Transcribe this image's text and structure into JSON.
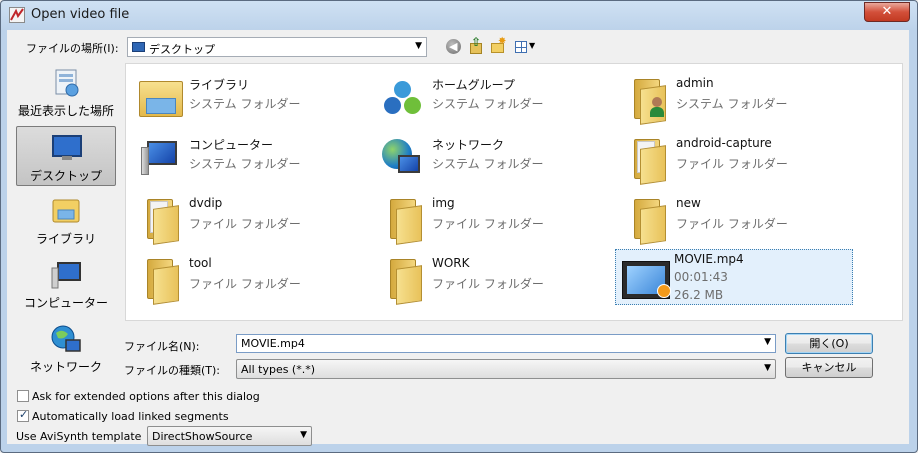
{
  "window": {
    "title": "Open video file",
    "close_glyph": "✕"
  },
  "lookin": {
    "label": "ファイルの場所(I):",
    "value": "デスクトップ",
    "arrow": "▼"
  },
  "toolbar": {
    "back_glyph": "◀",
    "up_glyph": "⇧",
    "new_folder_glyph": "✸",
    "view_arrow": "▼"
  },
  "places": [
    {
      "label": "最近表示した場所",
      "icon": "recent-places-icon"
    },
    {
      "label": "デスクトップ",
      "icon": "desktop-icon",
      "selected": true
    },
    {
      "label": "ライブラリ",
      "icon": "libraries-icon"
    },
    {
      "label": "コンピューター",
      "icon": "computer-icon"
    },
    {
      "label": "ネットワーク",
      "icon": "network-icon"
    }
  ],
  "files": [
    {
      "name": "ライブラリ",
      "type": "システム フォルダー",
      "icon": "library-icon"
    },
    {
      "name": "ホームグループ",
      "type": "システム フォルダー",
      "icon": "homegroup-icon"
    },
    {
      "name": "admin",
      "type": "システム フォルダー",
      "icon": "user-folder-icon"
    },
    {
      "name": "コンピューター",
      "type": "システム フォルダー",
      "icon": "computer-icon"
    },
    {
      "name": "ネットワーク",
      "type": "システム フォルダー",
      "icon": "network-icon"
    },
    {
      "name": "android-capture",
      "type": "ファイル フォルダー",
      "icon": "folder-icon"
    },
    {
      "name": "dvdip",
      "type": "ファイル フォルダー",
      "icon": "folder-icon"
    },
    {
      "name": "img",
      "type": "ファイル フォルダー",
      "icon": "folder-icon"
    },
    {
      "name": "new",
      "type": "ファイル フォルダー",
      "icon": "folder-icon"
    },
    {
      "name": "tool",
      "type": "ファイル フォルダー",
      "icon": "folder-icon"
    },
    {
      "name": "WORK",
      "type": "ファイル フォルダー",
      "icon": "folder-icon"
    },
    {
      "name": "MOVIE.mp4",
      "type": "00:01:43",
      "size": "26.2 MB",
      "icon": "video-file-icon",
      "selected": true
    }
  ],
  "filename": {
    "label": "ファイル名(N):",
    "value": "MOVIE.mp4",
    "arrow": "▼"
  },
  "filetype": {
    "label": "ファイルの種類(T):",
    "value": "All types (*.*)",
    "arrow": "▼"
  },
  "buttons": {
    "open": "開く(O)",
    "cancel": "キャンセル"
  },
  "options": {
    "extended": {
      "label": "Ask for extended options after this dialog",
      "checked": false
    },
    "linked": {
      "label": "Automatically load linked segments",
      "checked": true,
      "mark": "✓"
    },
    "avisynth_label": "Use AviSynth template",
    "avisynth_value": "DirectShowSource",
    "avisynth_arrow": "▼"
  }
}
